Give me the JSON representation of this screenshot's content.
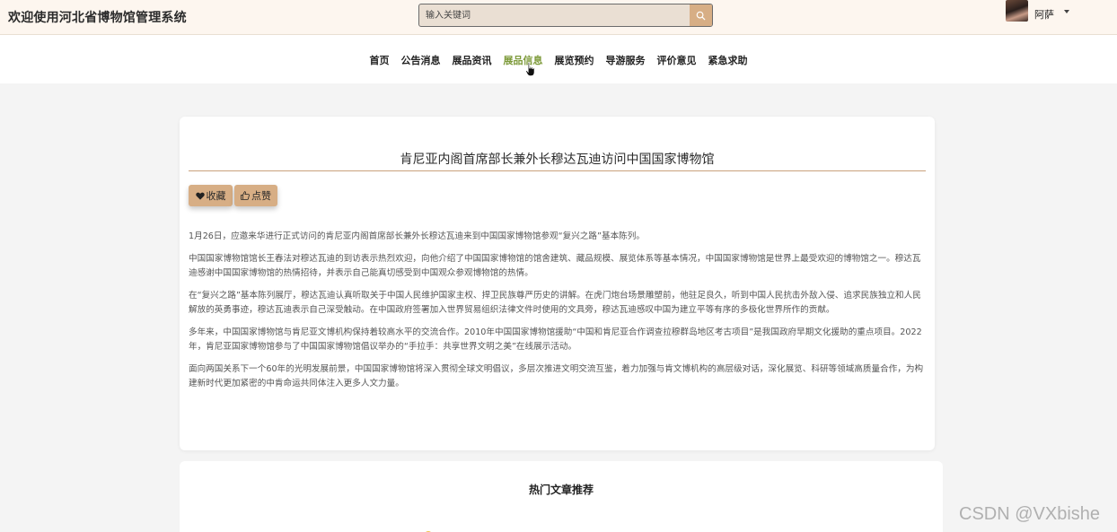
{
  "header": {
    "site_title": "欢迎使用河北省博物馆管理系统",
    "search_placeholder": "输入关键词",
    "username": "阿萨"
  },
  "nav": {
    "items": [
      "首页",
      "公告消息",
      "展品资讯",
      "展品信息",
      "展览预约",
      "导游服务",
      "评价意见",
      "紧急求助"
    ],
    "active": "展品信息"
  },
  "article": {
    "title": "肯尼亚内阁首席部长兼外长穆达瓦迪访问中国国家博物馆",
    "collect_label": "收藏",
    "like_label": "点赞",
    "paragraphs": [
      "1月26日，应邀来华进行正式访问的肯尼亚内阁首席部长兼外长穆达瓦迪来到中国国家博物馆参观“复兴之路”基本陈列。",
      "中国国家博物馆馆长王春法对穆达瓦迪的到访表示热烈欢迎，向他介绍了中国国家博物馆的馆舍建筑、藏品规模、展览体系等基本情况，中国国家博物馆是世界上最受欢迎的博物馆之一。穆达瓦迪感谢中国国家博物馆的热情招待，并表示自己能真切感受到中国观众参观博物馆的热情。",
      "在“复兴之路”基本陈列展厅，穆达瓦迪认真听取关于中国人民维护国家主权、捍卫民族尊严历史的讲解。在虎门炮台场景雕塑前，他驻足良久，听到中国人民抗击外敌入侵、追求民族独立和人民解放的英勇事迹，穆达瓦迪表示自己深受触动。在中国政府签署加入世界贸易组织法律文件时使用的文具旁，穆达瓦迪感叹中国为建立平等有序的多极化世界所作的贡献。",
      "多年来，中国国家博物馆与肯尼亚文博机构保持着较高水平的交流合作。2010年中国国家博物馆援助“中国和肯尼亚合作调查拉穆群岛地区考古项目”是我国政府早期文化援助的重点项目。2022年，肯尼亚国家博物馆参与了中国国家博物馆倡议举办的“手拉手：共享世界文明之美”在线展示活动。",
      "面向两国关系下一个60年的光明发展前景，中国国家博物馆将深入贯彻全球文明倡议，多层次推进文明交流互鉴，着力加强与肯文博机构的高层级对话，深化展览、科研等领域高质量合作，为构建新时代更加紧密的中肯命运共同体注入更多人文力量。"
    ]
  },
  "hot": {
    "title": "热门文章推荐"
  },
  "watermark": "CSDN @VXbishe",
  "colors": {
    "accent": "#d7ae85",
    "nav_active": "#7d9a3a",
    "header_bg": "#fdf6ef"
  }
}
